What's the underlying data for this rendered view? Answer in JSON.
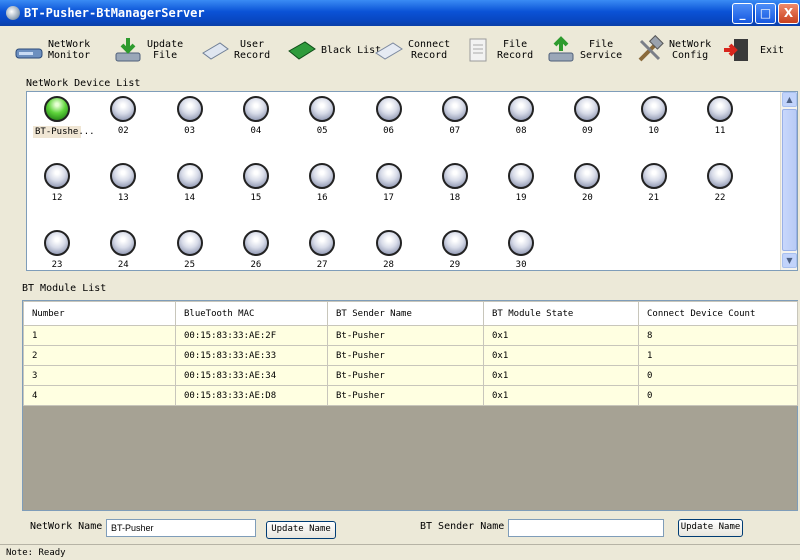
{
  "window": {
    "title": "BT-Pusher-BtManagerServer",
    "minimize": "_",
    "maximize": "□",
    "close": "X"
  },
  "toolbar": {
    "items": [
      {
        "label": "NetWork\nMonitor",
        "icon": "network-monitor-icon"
      },
      {
        "label": "Update\nFile",
        "icon": "update-file-icon"
      },
      {
        "label": "User\nRecord",
        "icon": "user-record-icon"
      },
      {
        "label": "Black List",
        "icon": "black-list-icon"
      },
      {
        "label": "Connect\nRecord",
        "icon": "connect-record-icon"
      },
      {
        "label": "File\nRecord",
        "icon": "file-record-icon"
      },
      {
        "label": "File\nService",
        "icon": "file-service-icon"
      },
      {
        "label": "NetWork\nConfig",
        "icon": "network-config-icon"
      },
      {
        "label": "Exit",
        "icon": "exit-icon"
      }
    ]
  },
  "device_list": {
    "label": "NetWork Device List",
    "devices": [
      "BT-Pushe...",
      "02",
      "03",
      "04",
      "05",
      "06",
      "07",
      "08",
      "09",
      "10",
      "11",
      "12",
      "13",
      "14",
      "15",
      "16",
      "17",
      "18",
      "19",
      "20",
      "21",
      "22",
      "23",
      "24",
      "25",
      "26",
      "27",
      "28",
      "29",
      "30"
    ],
    "active_device": "BT-Pushe..."
  },
  "module_list": {
    "label": "BT Module List",
    "columns": [
      "Number",
      "BlueTooth MAC",
      "BT Sender Name",
      "BT Module State",
      "Connect Device Count"
    ],
    "rows": [
      [
        "1",
        "00:15:83:33:AE:2F",
        "Bt-Pusher",
        "0x1",
        "8"
      ],
      [
        "2",
        "00:15:83:33:AE:33",
        "Bt-Pusher",
        "0x1",
        "1"
      ],
      [
        "3",
        "00:15:83:33:AE:34",
        "Bt-Pusher",
        "0x1",
        "0"
      ],
      [
        "4",
        "00:15:83:33:AE:D8",
        "Bt-Pusher",
        "0x1",
        "0"
      ]
    ]
  },
  "bottom": {
    "network_name_label": "NetWork Name",
    "network_name_value": "BT-Pusher",
    "update_name_button": "Update  Name",
    "sender_name_label": "BT Sender Name",
    "sender_name_value": "",
    "update_sender_button": "Update Name"
  },
  "status": {
    "text": "Note: Ready"
  }
}
